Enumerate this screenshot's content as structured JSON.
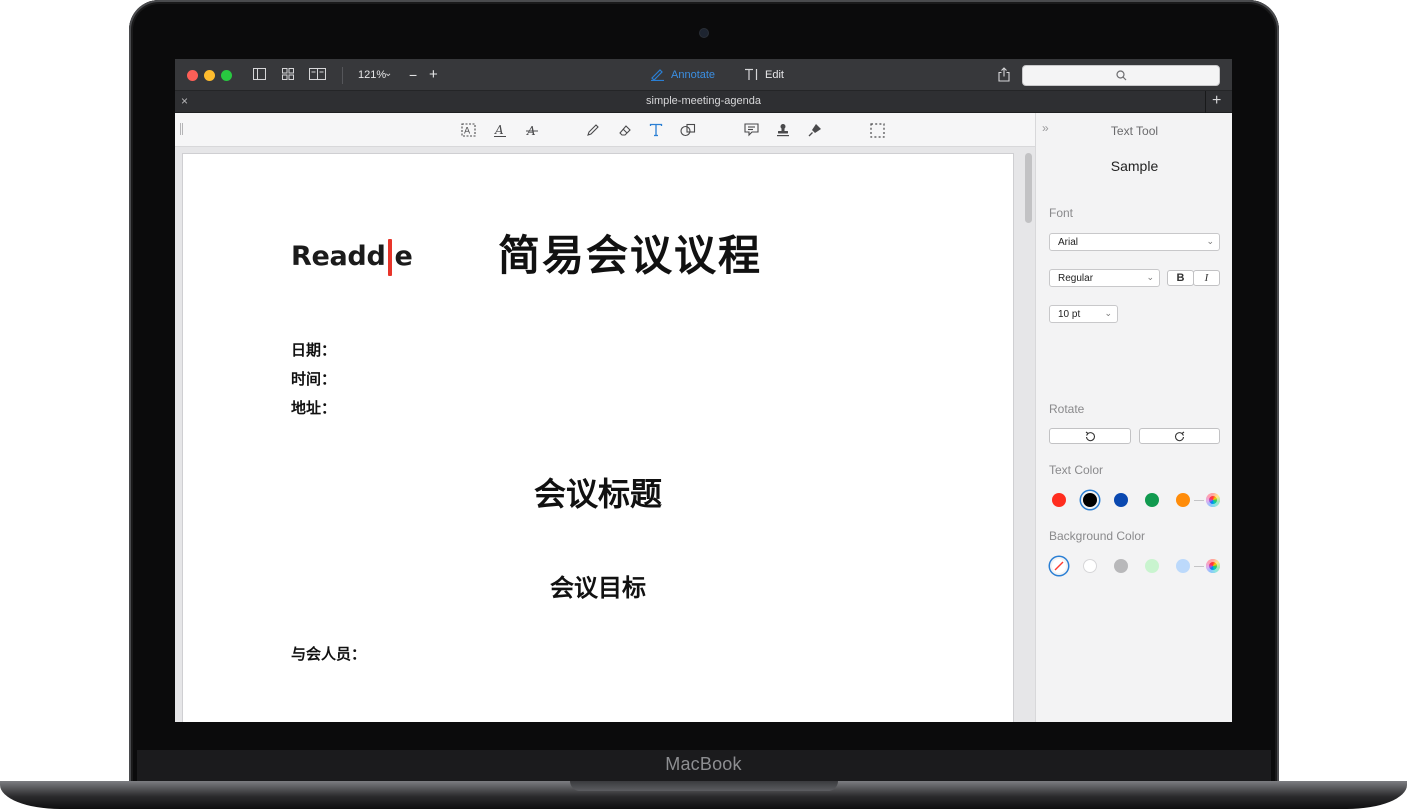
{
  "device": {
    "brand": "MacBook"
  },
  "toolbar": {
    "zoom": "121%",
    "zoom_out": "−",
    "zoom_in": "+",
    "annotate_label": "Annotate",
    "edit_label": "Edit"
  },
  "tab": {
    "title": "simple-meeting-agenda",
    "close": "×",
    "add": "+"
  },
  "document": {
    "logo_text_a": "Readd",
    "logo_text_b": "e",
    "title": "简易会议议程",
    "fields": [
      "日期：",
      "时间：",
      "地址："
    ],
    "meeting_title": "会议标题",
    "meeting_goal": "会议目标",
    "attendees": "与会人员："
  },
  "inspector": {
    "title": "Text Tool",
    "sample": "Sample",
    "font_label": "Font",
    "font_value": "Arial",
    "style_value": "Regular",
    "bold": "B",
    "italic": "I",
    "size_value": "10 pt",
    "rotate_label": "Rotate",
    "text_color_label": "Text Color",
    "bg_color_label": "Background Color",
    "text_colors": [
      "#ff2d1f",
      "#000000",
      "#0a48b0",
      "#119a4f",
      "#ff8c0a"
    ],
    "bg_colors": [
      "#ffffff",
      "#b8b8ba",
      "#c9f4cf",
      "#bcd9fb"
    ],
    "accent": "#2a7fd4"
  }
}
